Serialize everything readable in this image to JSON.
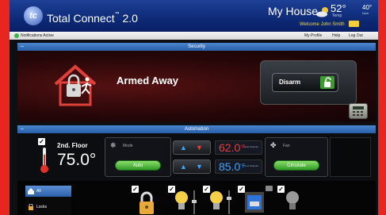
{
  "header": {
    "app_name": "Total Connect",
    "app_tm": "™",
    "app_version": "2.0",
    "logo_text": "tc",
    "location": "My House",
    "temp_main": "52°",
    "temp_main_label": "Temp",
    "temp_side": "40°",
    "temp_side_label": "Now",
    "welcome": "Welcome John Smith"
  },
  "navbar": {
    "notification": "Notifications Active",
    "links": [
      "My Profile",
      "Help",
      "Log Out"
    ]
  },
  "security": {
    "section_title": "Security",
    "collapse": "–",
    "status": "Armed Away",
    "disarm_label": "Disarm"
  },
  "automation": {
    "section_title": "Automation",
    "collapse": "–",
    "thermostat": {
      "name": "2nd. Floor",
      "current_temp": "75.0°",
      "mode_label": "Mode",
      "mode_value": "Auto",
      "heat_setpoint": "62.0",
      "heat_caption": "Heat Setpoint",
      "cool_setpoint": "85.0",
      "cool_caption": "Cool Setpoint",
      "unit": "°F",
      "fan_label": "Fan",
      "fan_value": "Circulate"
    }
  },
  "devices": {
    "filters": [
      "All",
      "Locks"
    ]
  },
  "colors": {
    "page_background": "#e8261f",
    "header_blue": "#0c2772",
    "section_bar": "#275fa8",
    "armed_red": "#551112",
    "heat_red": "#ef3a32",
    "cool_blue": "#3ca4ff",
    "accent_green": "#3c9c2f"
  }
}
